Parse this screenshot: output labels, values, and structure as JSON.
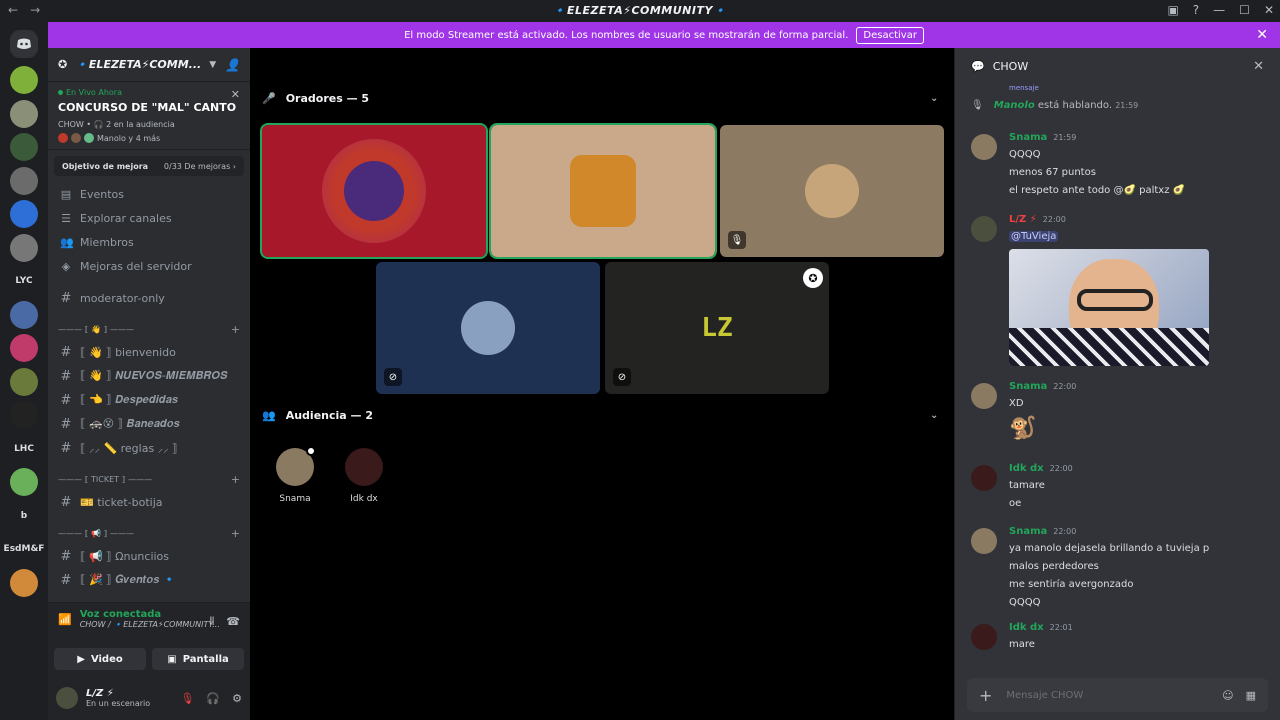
{
  "window": {
    "title": "🔹ELEZETA⚡COMMUNITY🔹",
    "back": "←",
    "forward": "→",
    "controls": [
      "▣",
      "?",
      "—",
      "☐",
      "✕"
    ]
  },
  "streamer": {
    "message": "El modo Streamer está activado. Los nombres de usuario se mostrarán de forma parcial.",
    "deactivate": "Desactivar",
    "close": "✕"
  },
  "rail": {
    "servers": [
      {
        "label": "",
        "color": "#7fb03a"
      },
      {
        "label": "",
        "color": "#8a8f78"
      },
      {
        "label": "",
        "color": "#3a5a3a"
      },
      {
        "label": "",
        "color": "#6b6b6b"
      },
      {
        "label": "",
        "color": "#2d6fd6"
      },
      {
        "label": "",
        "color": "#777777"
      },
      {
        "label": "LYC",
        "color": "#1e1f22"
      },
      {
        "label": "",
        "color": "#4a6aa6"
      },
      {
        "label": "",
        "color": "#c03a6a"
      },
      {
        "label": "",
        "color": "#6a7a3a"
      },
      {
        "label": "",
        "color": "#222222"
      },
      {
        "label": "LHC",
        "color": "#1f6fd0"
      },
      {
        "label": "",
        "color": "#6ab05a"
      },
      {
        "label": "b",
        "color": "#1e1f22"
      },
      {
        "label": "EsdM&F",
        "color": "#1e1f22"
      },
      {
        "label": "",
        "color": "#d08a3a"
      }
    ]
  },
  "sidebar": {
    "server_name": "🔹ELEZETA⚡COMM...",
    "live": {
      "status": "En Vivo Ahora",
      "title": "CONCURSO DE \"MAL\" CANTO",
      "meta": "CHOW • 🎧 2 en la audiencia",
      "speakers": "Manolo y 4 más"
    },
    "boost": {
      "label": "Objetivo de mejora",
      "count": "0/33 De mejoras ›"
    },
    "menu": [
      "Eventos",
      "Explorar canales",
      "Miembros",
      "Mejoras del servidor"
    ],
    "moderator_channel": "moderator-only",
    "cat1": "——— ⟦ 👋 ⟧ ———",
    "cat1_channels": [
      "⟦ 👋 ⟧ bienvenido",
      "⟦ 👋 ⟧ 𝑵𝑼𝑬𝑽𝑶𝑺-𝑴𝑰𝑬𝑴𝑩𝑹𝑶𝑺",
      "⟦ 👈 ⟧ 𝑫𝒆𝒔𝒑𝒆𝒅𝒊𝒅𝒂𝒔",
      "⟦ 🚓😵 ⟧ 𝑩𝒂𝒏𝒆𝒂𝒅𝒐𝒔",
      "⟦ ⸝⸝ 📏 reglas ⸝⸝ ⟧"
    ],
    "cat2": "——— ⟦ TICKET ⟧ ———",
    "cat2_channels": [
      "🎫 ticket-botija"
    ],
    "cat3": "——— ⟦ 📢 ⟧ ———",
    "cat3_channels": [
      "⟦ 📢 ⟧ Ωnunciios",
      "⟦ 🎉 ⟧ 𝑮𝒗𝒆𝒏𝒕𝒐𝒔 🔹"
    ]
  },
  "voice": {
    "status": "Voz conectada",
    "channel": "CHOW / 🔹ELEZETA⚡COMMUNITY...",
    "video": "Video",
    "screen": "Pantalla"
  },
  "user": {
    "name": "L/Z ⚡",
    "status": "En un escenario"
  },
  "stage": {
    "speakers_title": "Oradores — 5",
    "audience_title": "Audiencia — 2",
    "audience": [
      {
        "name": "Snama"
      },
      {
        "name": "Idk dx"
      }
    ],
    "tile_text_lz": "LZ"
  },
  "chat": {
    "channel": "CHOW",
    "unread_hint": "mensaje",
    "system": {
      "name": "Manolo",
      "text": "está hablando.",
      "time": "21:59"
    },
    "messages": [
      {
        "author": "Snama",
        "time": "21:59",
        "color": "#23a55a",
        "lines": [
          "QQQQ",
          "menos 67 puntos",
          "el respeto ante todo @🥑 paltxz 🥑"
        ]
      },
      {
        "author": "L/Z ⚡",
        "time": "22:00",
        "color": "#f23f43",
        "mention": "@TuVieja"
      },
      {
        "author": "Snama",
        "time": "22:00",
        "color": "#23a55a",
        "lines": [
          "XD",
          "🐒"
        ]
      },
      {
        "author": "Idk dx",
        "time": "22:00",
        "color": "#23a55a",
        "lines": [
          "tamare",
          "oe"
        ]
      },
      {
        "author": "Snama",
        "time": "22:00",
        "color": "#23a55a",
        "lines": [
          "ya manolo dejasela brillando a tuvieja p",
          "malos perdedores",
          "me sentiría avergonzado",
          "QQQQ"
        ]
      },
      {
        "author": "Idk dx",
        "time": "22:01",
        "color": "#23a55a",
        "lines": [
          "mare"
        ]
      }
    ],
    "composer_placeholder": "Mensaje CHOW"
  }
}
